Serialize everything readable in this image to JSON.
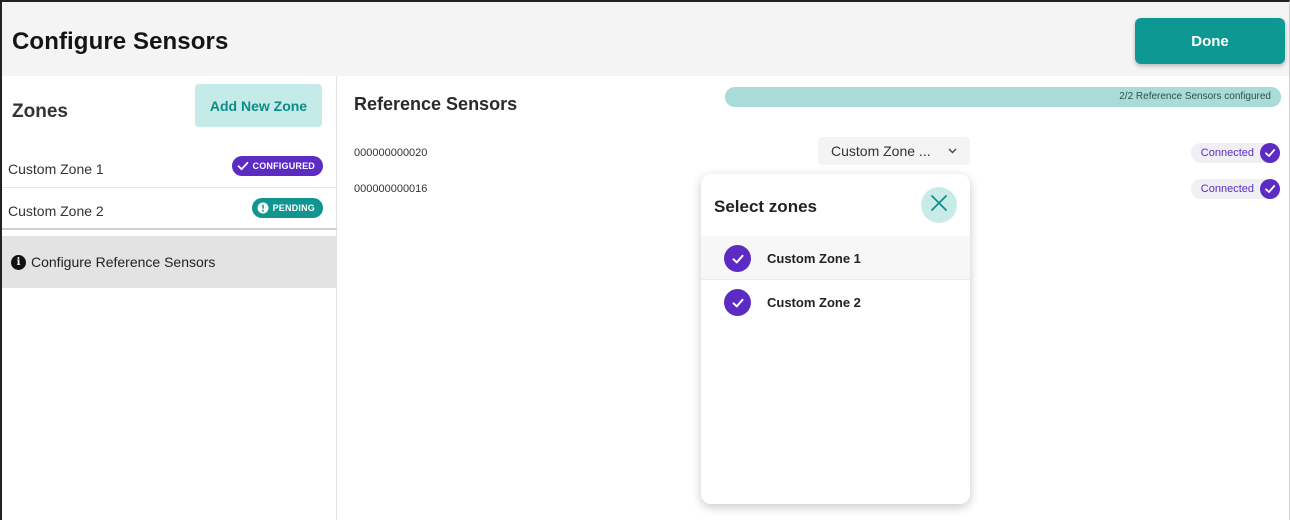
{
  "header": {
    "title": "Configure Sensors",
    "done_label": "Done"
  },
  "sidebar": {
    "zones_heading": "Zones",
    "add_zone_label": "Add New Zone",
    "zones": [
      {
        "name": "Custom Zone 1",
        "status": "CONFIGURED",
        "status_color": "#5b2bc4",
        "icon": "check-icon"
      },
      {
        "name": "Custom Zone 2",
        "status": "PENDING",
        "status_color": "#12958f",
        "icon": "exclamation-icon"
      }
    ],
    "configure_ref_label": "Configure Reference Sensors",
    "configure_ref_icon": "info-icon"
  },
  "main": {
    "title": "Reference Sensors",
    "progress": {
      "text": "2/2 Reference Sensors configured",
      "fraction": 1.0
    },
    "sensors": [
      {
        "id": "000000000020",
        "zone_value": "Custom Zone ...",
        "status": "Connected"
      },
      {
        "id": "000000000016",
        "status": "Connected"
      }
    ]
  },
  "popup": {
    "title": "Select zones",
    "items": [
      {
        "label": "Custom Zone 1",
        "checked": true
      },
      {
        "label": "Custom Zone 2",
        "checked": true
      }
    ]
  },
  "colors": {
    "accent_teal": "#0e9893",
    "accent_purple": "#5b2bc4",
    "light_teal": "#c5ebe8"
  }
}
